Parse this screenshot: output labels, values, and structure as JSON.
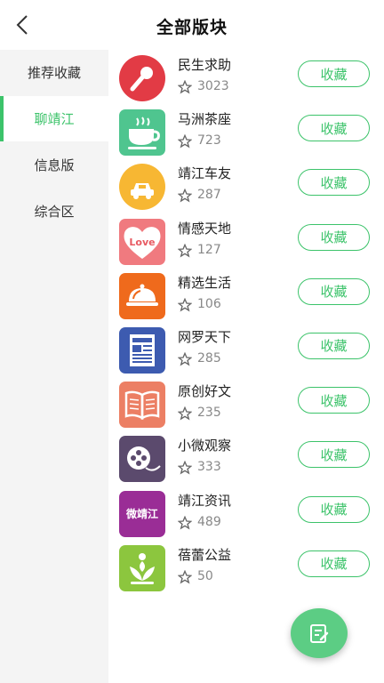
{
  "header": {
    "title": "全部版块"
  },
  "sidebar": {
    "items": [
      {
        "label": "推荐收藏",
        "active": false
      },
      {
        "label": "聊靖江",
        "active": true
      },
      {
        "label": "信息版",
        "active": false
      },
      {
        "label": "综合区",
        "active": false
      }
    ]
  },
  "boards": [
    {
      "name": "民生求助",
      "count": "3023",
      "button": "收藏",
      "icon": "microphone-icon",
      "color": "#e23b45"
    },
    {
      "name": "马洲茶座",
      "count": "723",
      "button": "收藏",
      "icon": "teacup-icon",
      "color": "#4fc58f"
    },
    {
      "name": "靖江车友",
      "count": "287",
      "button": "收藏",
      "icon": "car-icon",
      "color": "#f7b733"
    },
    {
      "name": "情感天地",
      "count": "127",
      "button": "收藏",
      "icon": "love-heart-icon",
      "color": "#f07a7f",
      "icon_text": "Love"
    },
    {
      "name": "精选生活",
      "count": "106",
      "button": "收藏",
      "icon": "food-cloche-icon",
      "color": "#ef6a1c"
    },
    {
      "name": "网罗天下",
      "count": "285",
      "button": "收藏",
      "icon": "newspaper-icon",
      "color": "#3d5bb0"
    },
    {
      "name": "原创好文",
      "count": "235",
      "button": "收藏",
      "icon": "open-book-icon",
      "color": "#ec7f64"
    },
    {
      "name": "小微观察",
      "count": "333",
      "button": "收藏",
      "icon": "film-reel-icon",
      "color": "#5b4a6d"
    },
    {
      "name": "靖江资讯",
      "count": "489",
      "button": "收藏",
      "icon": "weibo-badge-icon",
      "color": "#9a2d96",
      "icon_text": "微靖江"
    },
    {
      "name": "蓓蕾公益",
      "count": "50",
      "button": "收藏",
      "icon": "sprout-icon",
      "color": "#8cc63e"
    }
  ],
  "fab": {
    "icon": "edit-note-icon",
    "color": "#5ccd84"
  },
  "accent_color": "#3cc36a"
}
